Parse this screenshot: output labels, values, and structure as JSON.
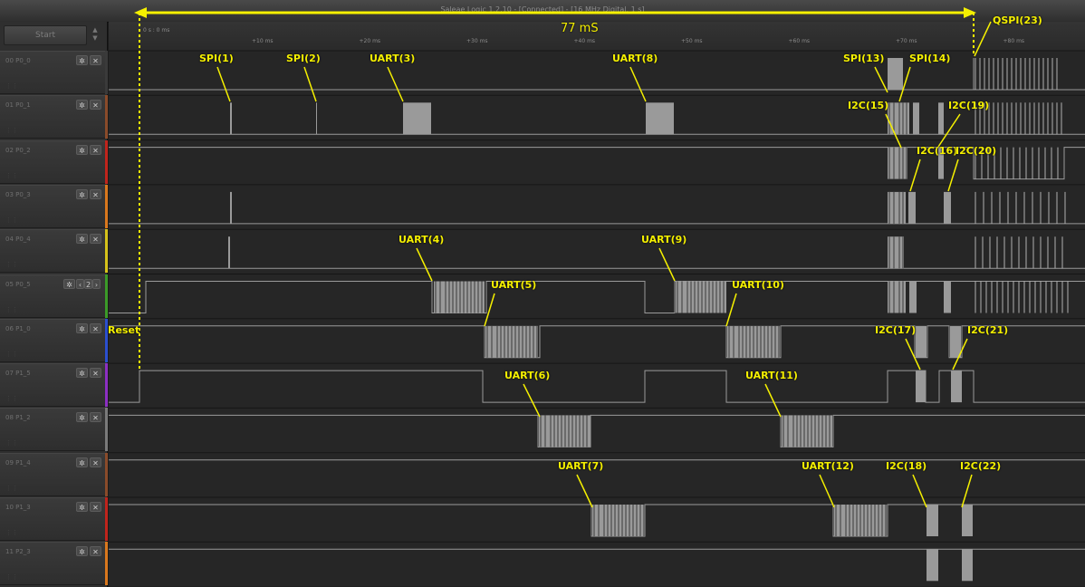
{
  "window": {
    "title": "Saleae Logic 1.2.10 - [Connected] - [16 MHz Digital, 1 s]"
  },
  "controls": {
    "start_label": "Start"
  },
  "ruler": {
    "origin_label": "0 s : 0 ms",
    "ticks": [
      "+10 ms",
      "+20 ms",
      "+30 ms",
      "+40 ms",
      "+50 ms",
      "+60 ms",
      "+70 ms",
      "+80 ms"
    ]
  },
  "channels": [
    {
      "index": "00",
      "name": "P0_0",
      "color": "#3a3a3a"
    },
    {
      "index": "01",
      "name": "P0_1",
      "color": "#8a4b2a"
    },
    {
      "index": "02",
      "name": "P0_2",
      "color": "#c0241c"
    },
    {
      "index": "03",
      "name": "P0_3",
      "color": "#d9771d"
    },
    {
      "index": "04",
      "name": "P0_4",
      "color": "#d6c21a"
    },
    {
      "index": "05",
      "name": "P0_5",
      "color": "#3b9a28"
    },
    {
      "index": "06",
      "name": "P1_0",
      "color": "#2b4fcf"
    },
    {
      "index": "07",
      "name": "P1_5",
      "color": "#8c2fc2"
    },
    {
      "index": "08",
      "name": "P1_2",
      "color": "#7a7a7a"
    },
    {
      "index": "09",
      "name": "P1_4",
      "color": "#8a4b2a"
    },
    {
      "index": "10",
      "name": "P1_3",
      "color": "#c0241c"
    },
    {
      "index": "11",
      "name": "P2_3",
      "color": "#d9771d"
    }
  ],
  "channel_controls": {
    "gear_icon": "gear-icon",
    "close_icon": "close-icon",
    "stepper_value": "2"
  },
  "annotations": {
    "span": "77 mS",
    "reset": "Reset",
    "labels": [
      "SPI(1)",
      "SPI(2)",
      "UART(3)",
      "UART(8)",
      "SPI(13)",
      "SPI(14)",
      "QSPI(23)",
      "I2C(15)",
      "I2C(19)",
      "I2C(16)",
      "I2C(20)",
      "UART(4)",
      "UART(9)",
      "UART(5)",
      "UART(10)",
      "I2C(17)",
      "I2C(21)",
      "UART(6)",
      "UART(11)",
      "UART(7)",
      "UART(12)",
      "I2C(18)",
      "I2C(22)"
    ]
  },
  "accent_color": "#f5f000"
}
